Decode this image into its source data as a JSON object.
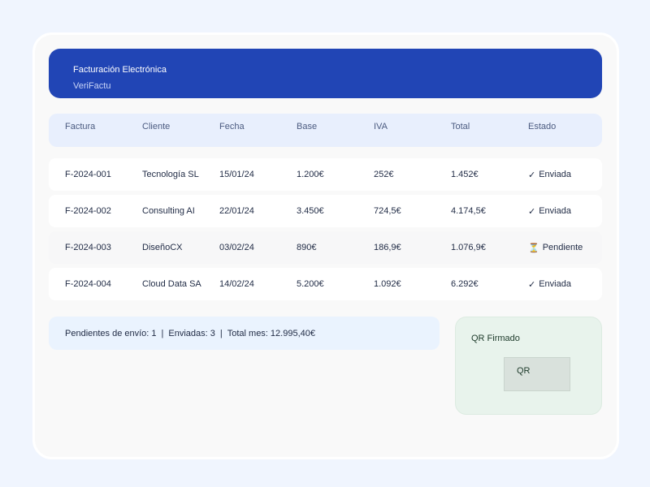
{
  "app": {
    "title": "Facturación Electrónica",
    "subtitle": "VeriFactu"
  },
  "table": {
    "headers": [
      "Factura",
      "Cliente",
      "Fecha",
      "Base",
      "IVA",
      "Total",
      "Estado"
    ],
    "rows": [
      {
        "factura": "F-2024-001",
        "cliente": "Tecnología SL",
        "fecha": "15/01/24",
        "base": "1.200€",
        "iva": "252€",
        "total": "1.452€",
        "estado": "Enviada",
        "estado_icon": "✓"
      },
      {
        "factura": "F-2024-002",
        "cliente": "Consulting AI",
        "fecha": "22/01/24",
        "base": "3.450€",
        "iva": "724,5€",
        "total": "4.174,5€",
        "estado": "Enviada",
        "estado_icon": "✓"
      },
      {
        "factura": "F-2024-003",
        "cliente": "DiseñoCX",
        "fecha": "03/02/24",
        "base": "890€",
        "iva": "186,9€",
        "total": "1.076,9€",
        "estado": "Pendiente",
        "estado_icon": "⏳"
      },
      {
        "factura": "F-2024-004",
        "cliente": "Cloud Data SA",
        "fecha": "14/02/24",
        "base": "5.200€",
        "iva": "1.092€",
        "total": "6.292€",
        "estado": "Enviada",
        "estado_icon": "✓"
      }
    ]
  },
  "summary": {
    "pending": "Pendientes de envío: 1",
    "sent": "Enviadas: 3",
    "total": "Total mes: 12.995,40€",
    "separator": "|"
  },
  "qr": {
    "title": "QR Firmado",
    "placeholder": "QR"
  },
  "colors": {
    "header_bg": "#2145b5",
    "thead_bg": "#e8effd",
    "summary_bg": "#eaf3fe",
    "qr_panel_bg": "#e8f3ec"
  }
}
